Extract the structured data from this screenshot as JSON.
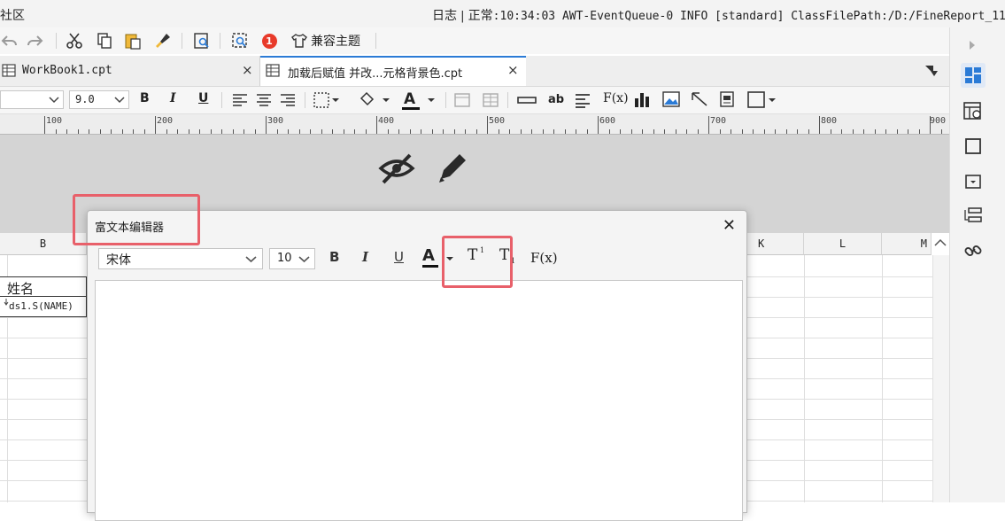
{
  "window": {
    "left_fragment": "社区",
    "log_label": "日志",
    "log_sep": "|",
    "log_level": "正常",
    "log_message": ":10:34:03 AWT-EventQueue-0 INFO [standard] ClassFilePath:/D:/FineReport_11."
  },
  "toolbar": {
    "compat_theme_label": "兼容主题",
    "notification_badge": "1"
  },
  "tabs": [
    {
      "label": "WorkBook1.cpt",
      "close": "×"
    },
    {
      "label": "加载后赋值 并改...元格背景色.cpt",
      "close": "×"
    }
  ],
  "format_toolbar": {
    "font_size": "9.0",
    "bold": "B",
    "italic": "I",
    "underline": "U",
    "text_sample": "ab",
    "formula": "F(x)"
  },
  "ruler": {
    "marks": [
      "100",
      "200",
      "300",
      "400",
      "500",
      "600",
      "700",
      "800",
      "900"
    ]
  },
  "grid": {
    "columns": [
      "B",
      "K",
      "L",
      "M"
    ],
    "cells": {
      "header_name": "姓名",
      "data_binding": "ds1.S(NAME)"
    }
  },
  "dialog": {
    "title": "富文本编辑器",
    "close": "✕",
    "font_family": "宋体",
    "font_size": "10",
    "bold": "B",
    "italic": "I",
    "underline": "U",
    "font_color_label": "A",
    "superscript_label": "T",
    "subscript_label": "T",
    "formula_label": "F(x)",
    "body_text": ""
  },
  "colors": {
    "highlight": "#e8606a",
    "gray_area": "#d4d4d4",
    "accent_blue": "#2b7bd6"
  }
}
